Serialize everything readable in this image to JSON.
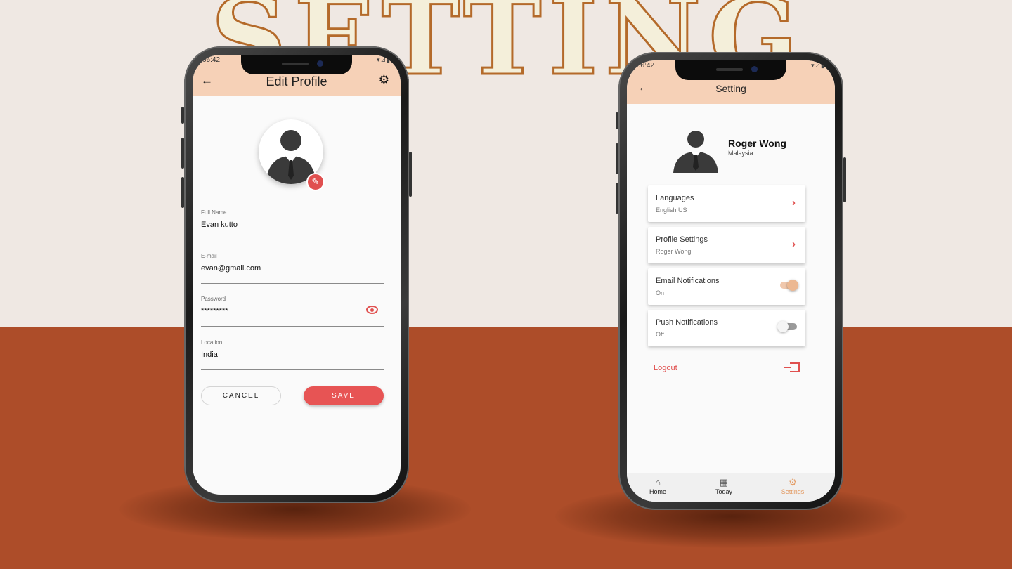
{
  "banner": {
    "text": "SETTING"
  },
  "edit_profile": {
    "status_time": "06:42",
    "status_icons": "▾⊿▮",
    "title": "Edit Profile",
    "back_icon": "arrow-left-icon",
    "settings_icon": "gear-icon",
    "avatar_icon": "person-silhouette-icon",
    "edit_icon": "pencil-icon",
    "fields": [
      {
        "label": "Full Name",
        "value": "Evan kutto"
      },
      {
        "label": "E-mail",
        "value": "evan@gmail.com"
      },
      {
        "label": "Password",
        "value": "*********"
      },
      {
        "label": "Location",
        "value": "India"
      }
    ],
    "visibility_icon": "eye-icon",
    "cancel_label": "CANCEL",
    "save_label": "SAVE"
  },
  "settings": {
    "status_time": "06:42",
    "status_icons": "▾⊿▮",
    "title": "Setting",
    "back_icon": "arrow-left-icon",
    "user": {
      "name": "Roger Wong",
      "country": "Malaysia"
    },
    "items": [
      {
        "title": "Languages",
        "subtitle": "English US",
        "control": "chevron"
      },
      {
        "title": "Profile Settings",
        "subtitle": "Roger Wong",
        "control": "chevron"
      },
      {
        "title": "Email Notifications",
        "subtitle": "On",
        "control": "toggle",
        "on": true
      },
      {
        "title": "Push Notifications",
        "subtitle": "Off",
        "control": "toggle",
        "on": false
      }
    ],
    "logout_label": "Logout",
    "nav": [
      {
        "label": "Home",
        "icon": "home-icon",
        "active": false
      },
      {
        "label": "Today",
        "icon": "calendar-icon",
        "active": false
      },
      {
        "label": "Settings",
        "icon": "gear-icon",
        "active": true
      }
    ]
  },
  "colors": {
    "accent_red": "#e0504f",
    "appbar_peach": "#f6d1b7",
    "active_orange": "#e39a62",
    "floor": "#ad4d29",
    "wall": "#efe8e3"
  }
}
